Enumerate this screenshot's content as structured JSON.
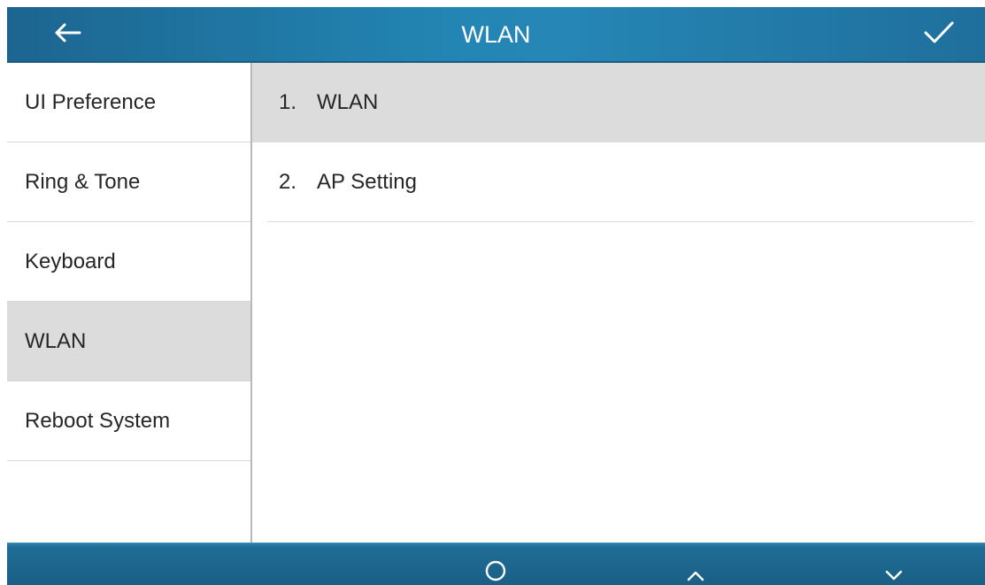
{
  "header": {
    "title": "WLAN",
    "back_icon": "arrow-left-icon",
    "confirm_icon": "checkmark-icon"
  },
  "sidebar": {
    "items": [
      {
        "label": "UI Preference",
        "selected": false
      },
      {
        "label": "Ring & Tone",
        "selected": false
      },
      {
        "label": "Keyboard",
        "selected": false
      },
      {
        "label": "WLAN",
        "selected": true
      },
      {
        "label": "Reboot System",
        "selected": false
      }
    ]
  },
  "main": {
    "items": [
      {
        "number": "1.",
        "label": "WLAN",
        "selected": true
      },
      {
        "number": "2.",
        "label": "AP Setting",
        "selected": false
      }
    ]
  },
  "softkeys": [
    {
      "icon": "circle-icon"
    },
    {
      "icon": "chevron-up-icon"
    },
    {
      "icon": "chevron-down-icon"
    }
  ],
  "colors": {
    "title_bar": "#2385b3",
    "bottom_bar": "#1a5f85",
    "selected_row": "#dcdcdc",
    "text": "#262626"
  }
}
